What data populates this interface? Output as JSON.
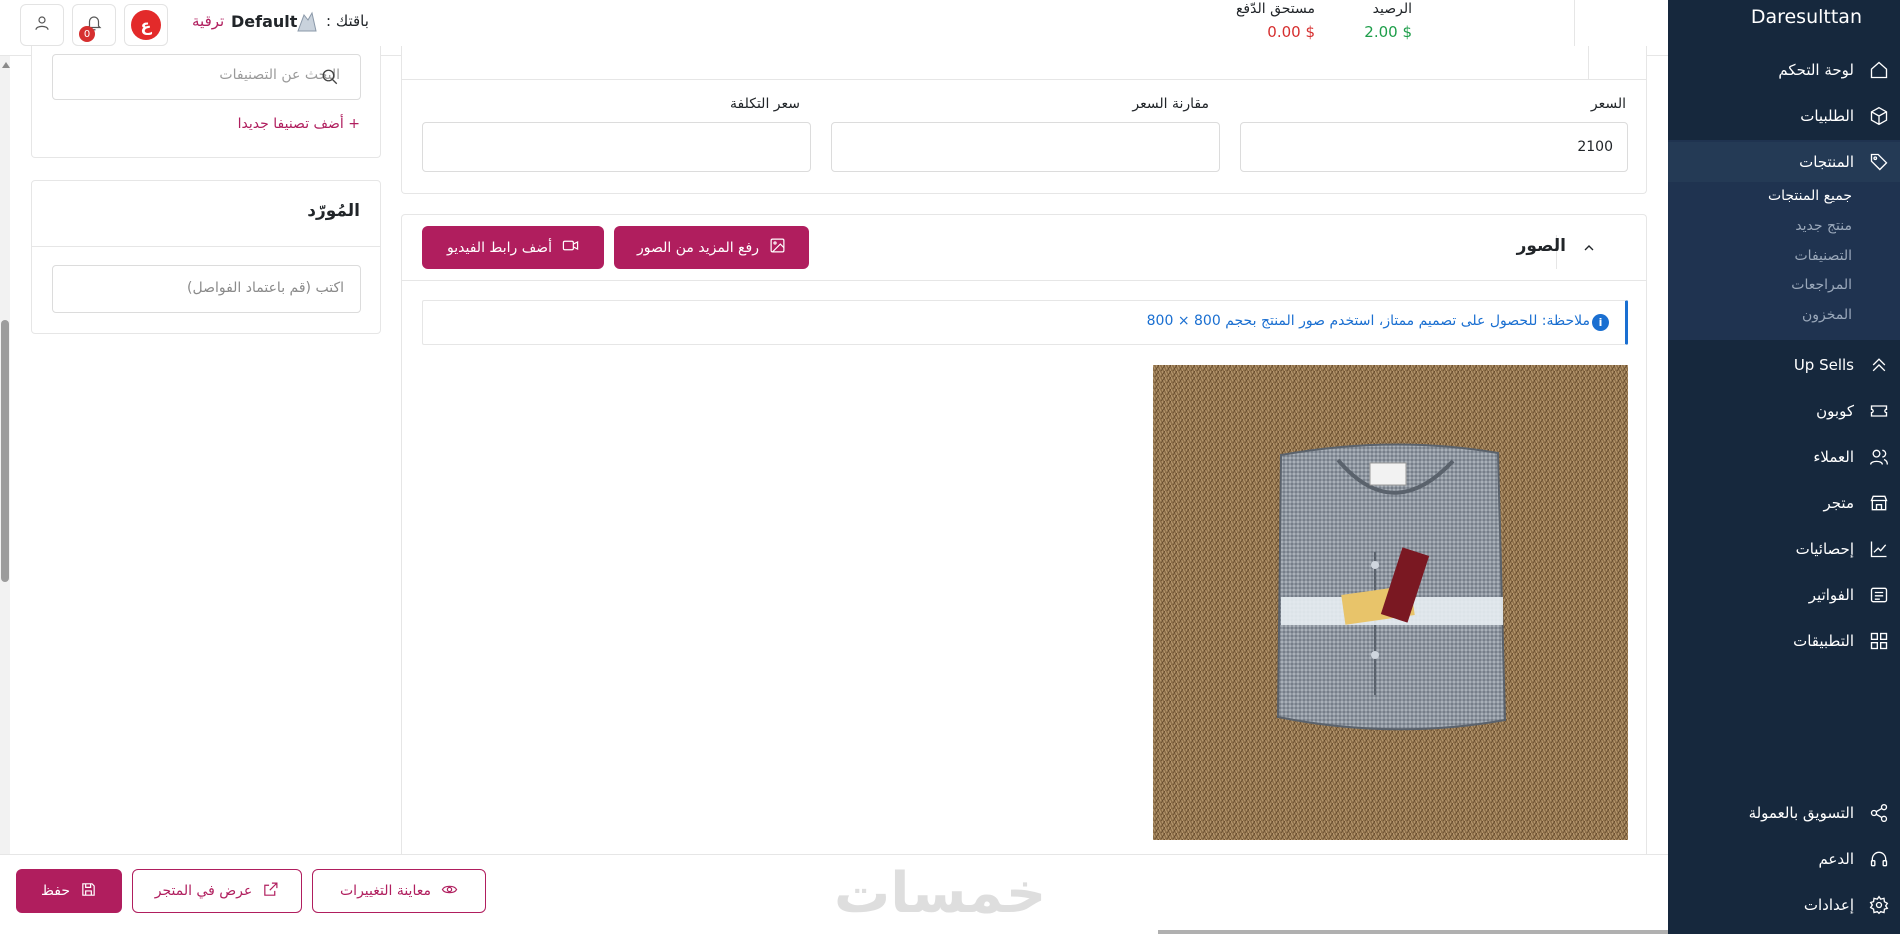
{
  "sidebar": {
    "brand": "Daresulttan",
    "items": [
      {
        "label": "لوحة التحكم",
        "icon": "home-icon"
      },
      {
        "label": "الطلبيات",
        "icon": "box-icon"
      },
      {
        "label": "المنتجات",
        "icon": "tag-icon"
      },
      {
        "label": "Up Sells",
        "icon": "chevrons-up-icon"
      },
      {
        "label": "كوبون",
        "icon": "ticket-icon"
      },
      {
        "label": "العملاء",
        "icon": "users-icon"
      },
      {
        "label": "متجر",
        "icon": "store-icon"
      },
      {
        "label": "إحصائيات",
        "icon": "chart-icon"
      },
      {
        "label": "الفواتير",
        "icon": "invoice-icon"
      },
      {
        "label": "التطبيقات",
        "icon": "grid-icon"
      }
    ],
    "products_submenu": [
      "جميع المنتجات",
      "منتج جديد",
      "التصنيفات",
      "المراجعات",
      "المخزون"
    ],
    "bottom_items": [
      {
        "label": "التسويق بالعمولة",
        "icon": "share-icon"
      },
      {
        "label": "الدعم",
        "icon": "headset-icon"
      },
      {
        "label": "إعدادات",
        "icon": "gear-icon"
      }
    ]
  },
  "topbar": {
    "balance_label": "الرصيد",
    "balance_value": "2.00 $",
    "due_label": "مستحق الدّفع",
    "due_value": "0.00 $",
    "plan_label": "باقتك :",
    "plan_name": "Default",
    "upgrade": "ترقية",
    "avatar_letter": "ع",
    "notifications_count": "0"
  },
  "pricing": {
    "price_label": "السعر",
    "price_value": "2100",
    "compare_label": "مقارنة السعر",
    "compare_value": "",
    "cost_label": "سعر التكلفة",
    "cost_value": ""
  },
  "images_section": {
    "title": "الصور",
    "upload_button": "رفع المزيد من الصور",
    "video_button": "أضف رابط الفيديو",
    "note": "ملاحظة: للحصول على تصميم ممتاز، استخدم صور المنتج بحجم 800 × 800"
  },
  "categories": {
    "search_placeholder": "البحث عن التصنيفات",
    "add_new": "+ أضف تصنيفا جديدا"
  },
  "supplier": {
    "title": "المُورّد",
    "placeholder": "اكتب (قم باعتماد الفواصل)"
  },
  "footer": {
    "save": "حفظ",
    "view_in_store": "عرض في المتجر",
    "preview_changes": "معاينة التغييرات",
    "watermark": "خمسات"
  },
  "colors": {
    "primary": "#b01e5e",
    "sidebar": "#16283d",
    "balance_green": "#1e9e4a",
    "due_red": "#d62f2f",
    "note_blue": "#1a6fd1"
  }
}
